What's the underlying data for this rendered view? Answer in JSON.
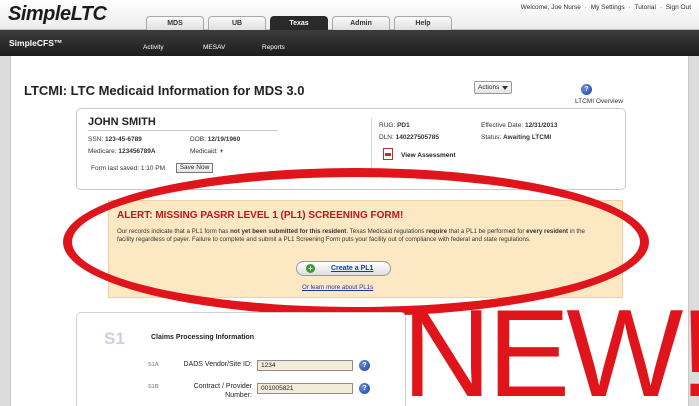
{
  "header": {
    "logo": "SimpleLTC",
    "welcome": "Welcome, Joe Nurse",
    "links": [
      "My Settings",
      "Tutorial",
      "Sign Out"
    ],
    "separator": "·",
    "tabs": [
      "MDS",
      "UB",
      "Texas",
      "Admin",
      "Help"
    ],
    "active_tab": "Texas"
  },
  "nav": {
    "brand": "SimpleCFS™",
    "links": [
      "Activity",
      "MESAV",
      "Reports"
    ]
  },
  "page": {
    "title": "LTCMI: LTC Medicaid Information for MDS 3.0",
    "actions_label": "Actions",
    "help_glyph": "?",
    "overview_label": "LTCMI Overview"
  },
  "resident": {
    "name": "JOHN SMITH",
    "ssn_label": "SSN:",
    "ssn": "123-45-6789",
    "dob_label": "DOB:",
    "dob": "12/19/1960",
    "medicare_label": "Medicare:",
    "medicare": "123456789A",
    "medicaid_label": "Medicaid:",
    "medicaid": "+",
    "rug_label": "RUG:",
    "rug": "PD1",
    "dln_label": "DLN:",
    "dln": "140227505785",
    "effective_label": "Effective Date:",
    "effective": "12/31/2013",
    "status_label": "Status:",
    "status": "Awaiting LTCMI",
    "saved_label": "Form last saved: 1:10 PM",
    "save_now": "Save Now",
    "view_assessment": "View Assessment"
  },
  "alert": {
    "title": "ALERT: MISSING PASRR LEVEL 1 (PL1) SCREENING FORM!",
    "body_1": "Our records indicate that a PL1 form has ",
    "body_bold_1": "not yet been submitted for this resident",
    "body_2": ". Texas Medicaid regulations ",
    "body_bold_2": "require",
    "body_3": " that a PL1 be performed for ",
    "body_bold_3": "every resident",
    "body_4": " in the facility regardless of payer. Failure to complete and submit a PL1 Screening Form puts your facility out of compliance with federal and state regulations.",
    "create_button": "Create a PL1",
    "plus_glyph": "+",
    "learn_link": "Or learn more about PL1s"
  },
  "section1": {
    "number": "S1",
    "title": "Claims Processing Information",
    "fields": [
      {
        "id": "S1A",
        "label": "DADS Vendor/Site ID:",
        "value": "1234"
      },
      {
        "id": "S1B",
        "label_line1": "Contract / Provider",
        "label_line2": "Number:",
        "value": "001005821"
      }
    ]
  },
  "overlay": {
    "new_text": "NEW!",
    "accent": "#e0141b"
  }
}
